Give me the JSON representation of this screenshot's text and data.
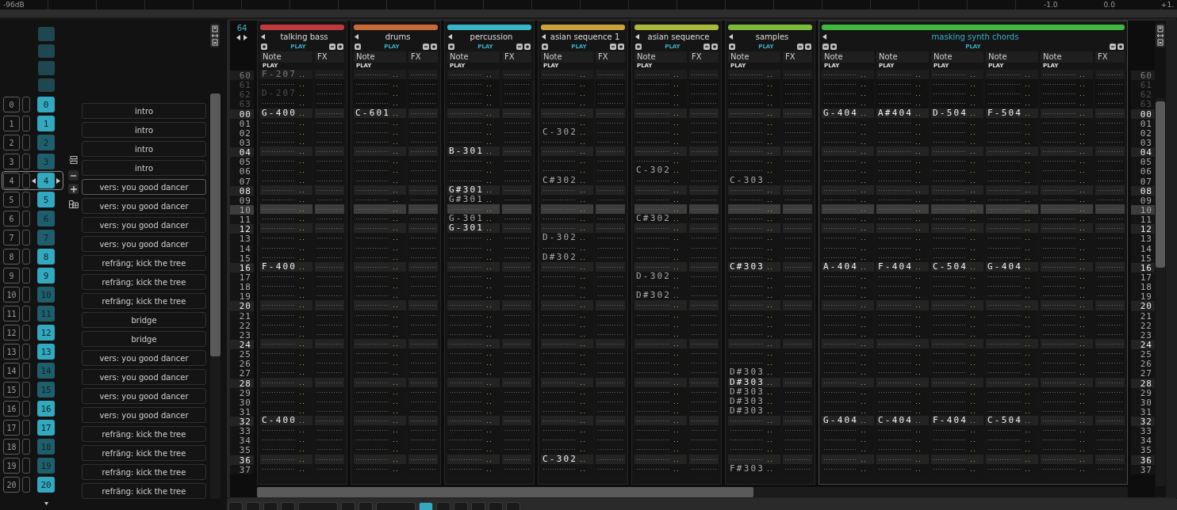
{
  "meter": {
    "left_label": "-96dB",
    "scale": [
      "-1.0",
      "0.0",
      "+1."
    ]
  },
  "sequence": {
    "slots": [
      {
        "index": "0",
        "pattern": "0",
        "name": "intro",
        "bright": true,
        "selected": false
      },
      {
        "index": "1",
        "pattern": "1",
        "name": "intro",
        "bright": true,
        "selected": false
      },
      {
        "index": "2",
        "pattern": "2",
        "name": "intro",
        "bright": false,
        "selected": false
      },
      {
        "index": "3",
        "pattern": "3",
        "name": "intro",
        "bright": false,
        "selected": false
      },
      {
        "index": "4",
        "pattern": "4",
        "name": "vers: you good dancer",
        "bright": true,
        "selected": true
      },
      {
        "index": "5",
        "pattern": "5",
        "name": "vers: you good dancer",
        "bright": true,
        "selected": false
      },
      {
        "index": "6",
        "pattern": "6",
        "name": "vers: you good dancer",
        "bright": false,
        "selected": false
      },
      {
        "index": "7",
        "pattern": "7",
        "name": "vers: you good dancer",
        "bright": false,
        "selected": false
      },
      {
        "index": "8",
        "pattern": "8",
        "name": "refräng; kick the tree",
        "bright": true,
        "selected": false
      },
      {
        "index": "9",
        "pattern": "9",
        "name": "refräng; kick the tree",
        "bright": true,
        "selected": false
      },
      {
        "index": "10",
        "pattern": "10",
        "name": "refräng; kick the tree",
        "bright": false,
        "selected": false
      },
      {
        "index": "11",
        "pattern": "11",
        "name": "bridge",
        "bright": false,
        "selected": false
      },
      {
        "index": "12",
        "pattern": "12",
        "name": "bridge",
        "bright": true,
        "selected": false
      },
      {
        "index": "13",
        "pattern": "13",
        "name": "vers: you good dancer",
        "bright": true,
        "selected": false
      },
      {
        "index": "14",
        "pattern": "14",
        "name": "vers: you good dancer",
        "bright": false,
        "selected": false
      },
      {
        "index": "15",
        "pattern": "15",
        "name": "vers: you good dancer",
        "bright": false,
        "selected": false
      },
      {
        "index": "16",
        "pattern": "16",
        "name": "vers: you good dancer",
        "bright": true,
        "selected": false
      },
      {
        "index": "17",
        "pattern": "17",
        "name": "refräng: kick the tree",
        "bright": true,
        "selected": false
      },
      {
        "index": "18",
        "pattern": "18",
        "name": "refräng: kick the tree",
        "bright": false,
        "selected": false
      },
      {
        "index": "19",
        "pattern": "19",
        "name": "refräng: kick the tree",
        "bright": false,
        "selected": false
      },
      {
        "index": "20",
        "pattern": "20",
        "name": "refräng: kick the tree",
        "bright": true,
        "selected": false
      }
    ]
  },
  "pattern": {
    "lines": "64",
    "tracks": [
      {
        "name": "talking bass",
        "color": "#c0393b",
        "selected": false,
        "status": "PLAY",
        "columns": [
          {
            "kind": "note",
            "label": "Note",
            "status": "PLAY"
          },
          {
            "kind": "fx",
            "label": "FX"
          }
        ]
      },
      {
        "name": "drums",
        "color": "#c8693a",
        "selected": false,
        "status": "PLAY",
        "columns": [
          {
            "kind": "note",
            "label": "Note",
            "status": "PLAY"
          },
          {
            "kind": "fx",
            "label": "FX"
          }
        ]
      },
      {
        "name": "percussion",
        "color": "#3bb4c8",
        "selected": false,
        "status": "PLAY",
        "columns": [
          {
            "kind": "note",
            "label": "Note",
            "status": "PLAY"
          },
          {
            "kind": "fx",
            "label": "FX"
          }
        ]
      },
      {
        "name": "asian sequence 1",
        "color": "#c9a23e",
        "selected": false,
        "status": "PLAY",
        "columns": [
          {
            "kind": "note",
            "label": "Note",
            "status": "PLAY"
          },
          {
            "kind": "fx",
            "label": "FX"
          }
        ]
      },
      {
        "name": "asian sequence",
        "color": "#a9b93d",
        "selected": false,
        "status": "PLAY",
        "columns": [
          {
            "kind": "note",
            "label": "Note",
            "status": "PLAY"
          },
          {
            "kind": "fx",
            "label": "FX"
          }
        ]
      },
      {
        "name": "samples",
        "color": "#7bbb3c",
        "selected": false,
        "status": "PLAY",
        "columns": [
          {
            "kind": "note",
            "label": "Note",
            "status": "PLAY"
          },
          {
            "kind": "fx",
            "label": "FX"
          }
        ]
      },
      {
        "name": "masking synth chords",
        "color": "#3fb83f",
        "selected": true,
        "status": "PLAY",
        "columns": [
          {
            "kind": "note",
            "label": "Note",
            "status": "PLAY"
          },
          {
            "kind": "note",
            "label": "Note",
            "status": "PLAY"
          },
          {
            "kind": "note",
            "label": "Note",
            "status": "PLAY"
          },
          {
            "kind": "note",
            "label": "Note",
            "status": "PLAY"
          },
          {
            "kind": "note",
            "label": "Note",
            "status": "PLAY"
          },
          {
            "kind": "fx",
            "label": "FX"
          }
        ]
      }
    ],
    "rows": [
      {
        "label": "60",
        "kind": "ghost_beat",
        "selected": false,
        "notes": [
          {
            "note": "F-207"
          }
        ]
      },
      {
        "label": "61",
        "kind": "ghost",
        "selected": false
      },
      {
        "label": "62",
        "kind": "ghost",
        "selected": false,
        "notes": [
          {
            "note": "D-207"
          }
        ]
      },
      {
        "label": "63",
        "kind": "ghost",
        "selected": false
      },
      {
        "label": "00",
        "kind": "beat",
        "selected": false,
        "notes": [
          {
            "note": "G-400"
          },
          {
            "note": "C-601"
          },
          {
            "empty": true
          },
          {
            "empty": true
          },
          {
            "empty": true
          },
          {
            "empty": true
          },
          {
            "note": "G-404"
          },
          {
            "note": "A#404"
          },
          {
            "note": "D-504"
          },
          {
            "note": "F-504"
          }
        ]
      },
      {
        "label": "01",
        "kind": "off",
        "selected": false
      },
      {
        "label": "02",
        "kind": "off",
        "selected": false,
        "notes": [
          {
            "empty": true
          },
          {
            "empty": true
          },
          {
            "empty": true
          },
          {
            "note": "C-302"
          }
        ]
      },
      {
        "label": "03",
        "kind": "off",
        "selected": false
      },
      {
        "label": "04",
        "kind": "beat",
        "selected": false,
        "notes": [
          {
            "empty": true
          },
          {
            "empty": true
          },
          {
            "note": "B-301"
          }
        ]
      },
      {
        "label": "05",
        "kind": "off",
        "selected": false
      },
      {
        "label": "06",
        "kind": "off",
        "selected": false,
        "notes": [
          {
            "empty": true
          },
          {
            "empty": true
          },
          {
            "empty": true
          },
          {
            "empty": true
          },
          {
            "note": "C-302"
          }
        ]
      },
      {
        "label": "07",
        "kind": "off",
        "selected": false,
        "notes": [
          {
            "empty": true
          },
          {
            "empty": true
          },
          {
            "empty": true
          },
          {
            "note": "C#302"
          },
          {
            "empty": true
          },
          {
            "note": "C-303"
          }
        ]
      },
      {
        "label": "08",
        "kind": "beat",
        "selected": false,
        "notes": [
          {
            "empty": true
          },
          {
            "empty": true
          },
          {
            "note": "G#301"
          }
        ]
      },
      {
        "label": "09",
        "kind": "off",
        "selected": false,
        "notes": [
          {
            "empty": true
          },
          {
            "empty": true
          },
          {
            "note": "G#301"
          }
        ]
      },
      {
        "label": "10",
        "kind": "off",
        "selected": true
      },
      {
        "label": "11",
        "kind": "off",
        "selected": false,
        "notes": [
          {
            "empty": true
          },
          {
            "empty": true
          },
          {
            "note": "G-301"
          },
          {
            "empty": true
          },
          {
            "note": "C#302"
          }
        ]
      },
      {
        "label": "12",
        "kind": "beat",
        "selected": false,
        "notes": [
          {
            "empty": true
          },
          {
            "empty": true
          },
          {
            "note": "G-301"
          }
        ]
      },
      {
        "label": "13",
        "kind": "off",
        "selected": false,
        "notes": [
          {
            "empty": true
          },
          {
            "empty": true
          },
          {
            "empty": true
          },
          {
            "note": "D-302"
          }
        ]
      },
      {
        "label": "14",
        "kind": "off",
        "selected": false
      },
      {
        "label": "15",
        "kind": "off",
        "selected": false,
        "notes": [
          {
            "empty": true
          },
          {
            "empty": true
          },
          {
            "empty": true
          },
          {
            "note": "D#302"
          }
        ]
      },
      {
        "label": "16",
        "kind": "beat",
        "selected": false,
        "notes": [
          {
            "note": "F-400"
          },
          {
            "empty": true
          },
          {
            "empty": true
          },
          {
            "empty": true
          },
          {
            "empty": true
          },
          {
            "note": "C#303"
          },
          {
            "note": "A-404"
          },
          {
            "note": "F-404"
          },
          {
            "note": "C-504"
          },
          {
            "note": "G-404"
          }
        ]
      },
      {
        "label": "17",
        "kind": "off",
        "selected": false,
        "notes": [
          {
            "empty": true
          },
          {
            "empty": true
          },
          {
            "empty": true
          },
          {
            "empty": true
          },
          {
            "note": "D-302"
          }
        ]
      },
      {
        "label": "18",
        "kind": "off",
        "selected": false
      },
      {
        "label": "19",
        "kind": "off",
        "selected": false,
        "notes": [
          {
            "empty": true
          },
          {
            "empty": true
          },
          {
            "empty": true
          },
          {
            "empty": true
          },
          {
            "note": "D#302"
          }
        ]
      },
      {
        "label": "20",
        "kind": "beat",
        "selected": false
      },
      {
        "label": "21",
        "kind": "off",
        "selected": false
      },
      {
        "label": "22",
        "kind": "off",
        "selected": false
      },
      {
        "label": "23",
        "kind": "off",
        "selected": false
      },
      {
        "label": "24",
        "kind": "beat",
        "selected": false
      },
      {
        "label": "25",
        "kind": "off",
        "selected": false
      },
      {
        "label": "26",
        "kind": "off",
        "selected": false
      },
      {
        "label": "27",
        "kind": "off",
        "selected": false,
        "notes": [
          {
            "empty": true
          },
          {
            "empty": true
          },
          {
            "empty": true
          },
          {
            "empty": true
          },
          {
            "empty": true
          },
          {
            "note": "D#303"
          }
        ]
      },
      {
        "label": "28",
        "kind": "beat",
        "selected": false,
        "notes": [
          {
            "empty": true
          },
          {
            "empty": true
          },
          {
            "empty": true
          },
          {
            "empty": true
          },
          {
            "empty": true
          },
          {
            "note": "D#303"
          }
        ]
      },
      {
        "label": "29",
        "kind": "off",
        "selected": false,
        "notes": [
          {
            "empty": true
          },
          {
            "empty": true
          },
          {
            "empty": true
          },
          {
            "empty": true
          },
          {
            "empty": true
          },
          {
            "note": "D#303"
          }
        ]
      },
      {
        "label": "30",
        "kind": "off",
        "selected": false,
        "notes": [
          {
            "empty": true
          },
          {
            "empty": true
          },
          {
            "empty": true
          },
          {
            "empty": true
          },
          {
            "empty": true
          },
          {
            "note": "D#303"
          }
        ]
      },
      {
        "label": "31",
        "kind": "off",
        "selected": false,
        "notes": [
          {
            "empty": true
          },
          {
            "empty": true
          },
          {
            "empty": true
          },
          {
            "empty": true
          },
          {
            "empty": true
          },
          {
            "note": "D#303"
          }
        ]
      },
      {
        "label": "32",
        "kind": "beat",
        "selected": false,
        "notes": [
          {
            "note": "C-400"
          },
          {
            "empty": true
          },
          {
            "empty": true
          },
          {
            "empty": true
          },
          {
            "empty": true
          },
          {
            "empty": true
          },
          {
            "note": "G-404"
          },
          {
            "note": "C-404"
          },
          {
            "note": "F-404"
          },
          {
            "note": "C-504"
          }
        ]
      },
      {
        "label": "33",
        "kind": "off",
        "selected": false
      },
      {
        "label": "34",
        "kind": "off",
        "selected": false
      },
      {
        "label": "35",
        "kind": "off",
        "selected": false
      },
      {
        "label": "36",
        "kind": "beat",
        "selected": false,
        "notes": [
          {
            "empty": true
          },
          {
            "empty": true
          },
          {
            "empty": true
          },
          {
            "note": "C-302"
          }
        ]
      },
      {
        "label": "37",
        "kind": "off",
        "selected": false,
        "notes": [
          {
            "empty": true
          },
          {
            "empty": true
          },
          {
            "empty": true
          },
          {
            "empty": true
          },
          {
            "empty": true
          },
          {
            "note": "F#303"
          }
        ]
      }
    ],
    "right_line_numbers": [
      "60",
      "61",
      "62",
      "63",
      "00",
      "01",
      "02",
      "03",
      "04",
      "05",
      "06",
      "07",
      "08",
      "09",
      "10",
      "11",
      "12",
      "13",
      "14",
      "15",
      "16",
      "17",
      "18",
      "19",
      "20",
      "21",
      "22",
      "23",
      "24",
      "25",
      "26",
      "27",
      "28",
      "29",
      "30",
      "31",
      "32",
      "33",
      "34",
      "35",
      "36",
      "37"
    ]
  },
  "bottom_toolbar": [
    {
      "kind": "button",
      "selected": false
    },
    {
      "kind": "button",
      "selected": false
    },
    {
      "kind": "button",
      "selected": false
    },
    {
      "kind": "button",
      "selected": false
    },
    {
      "kind": "field",
      "selected": false
    },
    {
      "kind": "button",
      "selected": false
    },
    {
      "kind": "button",
      "selected": false
    },
    {
      "kind": "field",
      "selected": false
    },
    {
      "kind": "button",
      "selected": true
    },
    {
      "kind": "button",
      "selected": false
    },
    {
      "kind": "button",
      "selected": false
    },
    {
      "kind": "button",
      "selected": false
    },
    {
      "kind": "button",
      "selected": false
    },
    {
      "kind": "button",
      "selected": false
    }
  ]
}
